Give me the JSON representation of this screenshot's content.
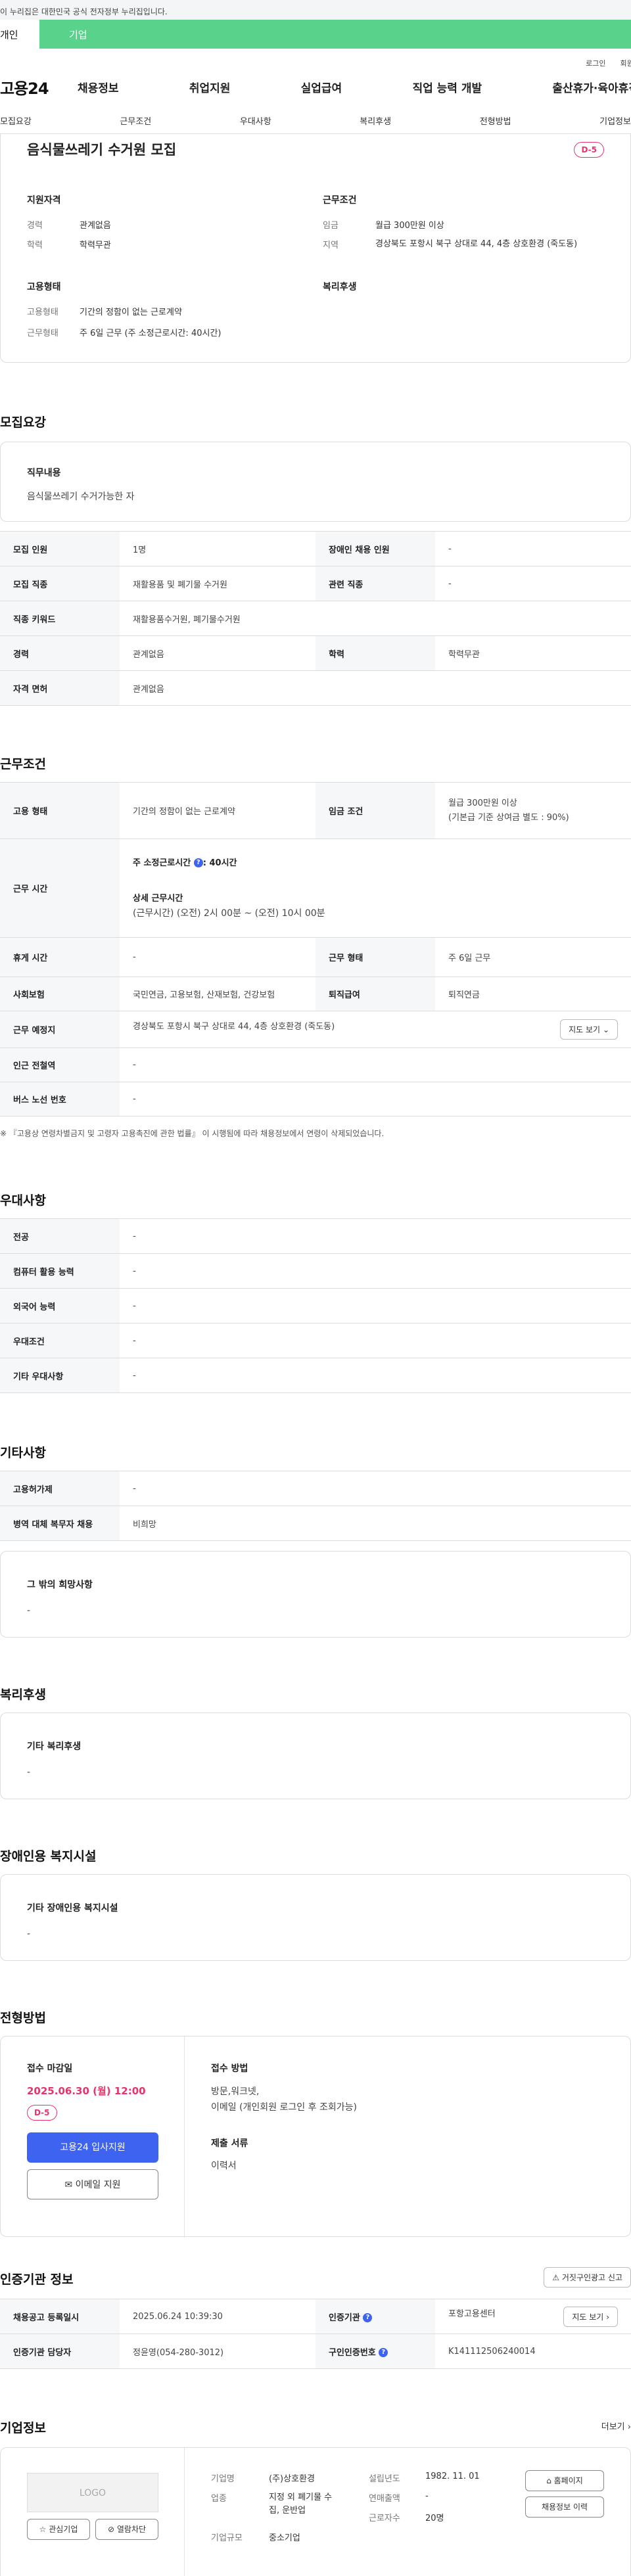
{
  "gov_banner": "이 누리집은 대한민국 공식 전자정부 누리집입니다.",
  "user_tabs": {
    "individual": "개인",
    "business": "기업"
  },
  "util_links": {
    "login": "로그인",
    "join": "회원가입"
  },
  "logo": "고용24",
  "gnb": [
    "채용정보",
    "취업지원",
    "실업급여",
    "직업 능력 개발",
    "출산휴가·육아휴직"
  ],
  "anchor_tabs": [
    "모집요강",
    "근무조건",
    "우대사항",
    "복리후생",
    "전형방법",
    "기업정보"
  ],
  "summary": {
    "title": "음식물쓰레기 수거원 모집",
    "dday": "D-5",
    "qual_head": "지원자격",
    "career_l": "경력",
    "career_v": "관계없음",
    "edu_l": "학력",
    "edu_v": "학력무관",
    "cond_head": "근무조건",
    "wage_l": "임금",
    "wage_v": "월급 300만원 이상",
    "region_l": "지역",
    "region_v": "경상북도 포항시 북구 상대로 44, 4층 상호환경 (죽도동)",
    "emp_head": "고용형태",
    "etype_l": "고용형태",
    "etype_v": "기간의 정함이 없는 근로계약",
    "wform_l": "근무형태",
    "wform_v": "주 6일 근무 (주 소정근로시간: 40시간)",
    "welfare_head": "복리후생"
  },
  "recruit": {
    "heading": "모집요강",
    "job_title": "직무내용",
    "job_desc": "음식물쓰레기 수거가능한 자",
    "rows": {
      "count_l": "모집 인원",
      "count_v": "1명",
      "disabled_l": "장애인 채용 인원",
      "disabled_v": "-",
      "job_l": "모집 직종",
      "job_v": "재활용품 및 폐기물 수거원",
      "rel_l": "관련 직종",
      "rel_v": "-",
      "kw_l": "직종 키워드",
      "kw_v": "재활용품수거원, 폐기물수거원",
      "career_l": "경력",
      "career_v": "관계없음",
      "edu_l": "학력",
      "edu_v": "학력무관",
      "lic_l": "자격 면허",
      "lic_v": "관계없음"
    }
  },
  "conditions": {
    "heading": "근무조건",
    "etype_l": "고용 형태",
    "etype_v": "기간의 정함이 없는 근로계약",
    "wage_l": "임금 조건",
    "wage_v1": "월급 300만원 이상",
    "wage_v2": "(기본급 기준 상여금 별도 : 90%)",
    "hours_l": "근무 시간",
    "hours_week": "주 소정근로시간",
    "hours_week_v": ": 40시간",
    "hours_detail_t": "상세 근무시간",
    "hours_detail_v": "(근무시간) (오전) 2시 00분 ~ (오전) 10시 00분",
    "break_l": "휴게 시간",
    "break_v": "-",
    "wform_l": "근무 형태",
    "wform_v": "주 6일 근무",
    "ins_l": "사회보험",
    "ins_v": "국민연금, 고용보험, 산재보험, 건강보험",
    "sev_l": "퇴직급여",
    "sev_v": "퇴직연금",
    "place_l": "근무 예정지",
    "place_v": "경상북도 포항시 북구 상대로 44, 4층 상호환경 (죽도동)",
    "map_btn": "지도 보기",
    "station_l": "인근 전철역",
    "station_v": "-",
    "bus_l": "버스 노선 번호",
    "bus_v": "-",
    "note": "※ 『고용상 연령차별금지 및 고령자 고용촉진에 관한 법률』 이 시행됨에 따라 채용정보에서 연령이 삭제되었습니다."
  },
  "prefer": {
    "heading": "우대사항",
    "rows": [
      {
        "l": "전공",
        "v": "-"
      },
      {
        "l": "컴퓨터 활용 능력",
        "v": "-"
      },
      {
        "l": "외국어 능력",
        "v": "-"
      },
      {
        "l": "우대조건",
        "v": "-"
      },
      {
        "l": "기타 우대사항",
        "v": "-"
      }
    ]
  },
  "etc": {
    "heading": "기타사항",
    "emp_l": "고용허가제",
    "emp_v": "-",
    "mil_l": "병역 대체 복무자 채용",
    "mil_v": "비희망",
    "other_t": "그 밖의 희망사항",
    "other_v": "-"
  },
  "welfare": {
    "heading": "복리후생",
    "t": "기타 복리후생",
    "v": "-"
  },
  "facility": {
    "heading": "장애인용 복지시설",
    "t": "기타 장애인용 복지시설",
    "v": "-"
  },
  "process": {
    "heading": "전형방법",
    "deadline_l": "접수 마감일",
    "deadline_v": "2025.06.30 (월) 12:00",
    "dday": "D-5",
    "apply_btn": "고용24 입사지원",
    "email_btn": "이메일 지원",
    "method_l": "접수 방법",
    "method_v1": "방문,워크넷,",
    "method_v2": "이메일 (개인회원 로그인 후 조회가능)",
    "docs_l": "제출 서류",
    "docs_v": "이력서"
  },
  "cert": {
    "heading": "인증기관 정보",
    "report_btn": "거짓구인광고 신고",
    "reg_l": "채용공고 등록일시",
    "reg_v": "2025.06.24 10:39:30",
    "org_l": "인증기관",
    "org_v": "포항고용센터",
    "map_btn": "지도 보기",
    "mgr_l": "인증기관 담당자",
    "mgr_v": "정윤영(054-280-3012)",
    "num_l": "구인인증번호",
    "num_v": "K141112506240014"
  },
  "company": {
    "heading": "기업정보",
    "more": "더보기",
    "logo": "LOGO",
    "fav_btn": "관심기업",
    "block_btn": "열람차단",
    "name_l": "기업명",
    "name_v": "(주)상호환경",
    "ind_l": "업종",
    "ind_v1": "지정 외 폐기물 수",
    "ind_v2": "집, 운반업",
    "size_l": "기업규모",
    "size_v": "중소기업",
    "est_l": "설립년도",
    "est_v": "1982. 11. 01",
    "sales_l": "연매출액",
    "sales_v": "-",
    "emp_l": "근로자수",
    "emp_v": "20명",
    "home_btn": "홈페이지",
    "hist_btn": "채용정보 이력"
  }
}
